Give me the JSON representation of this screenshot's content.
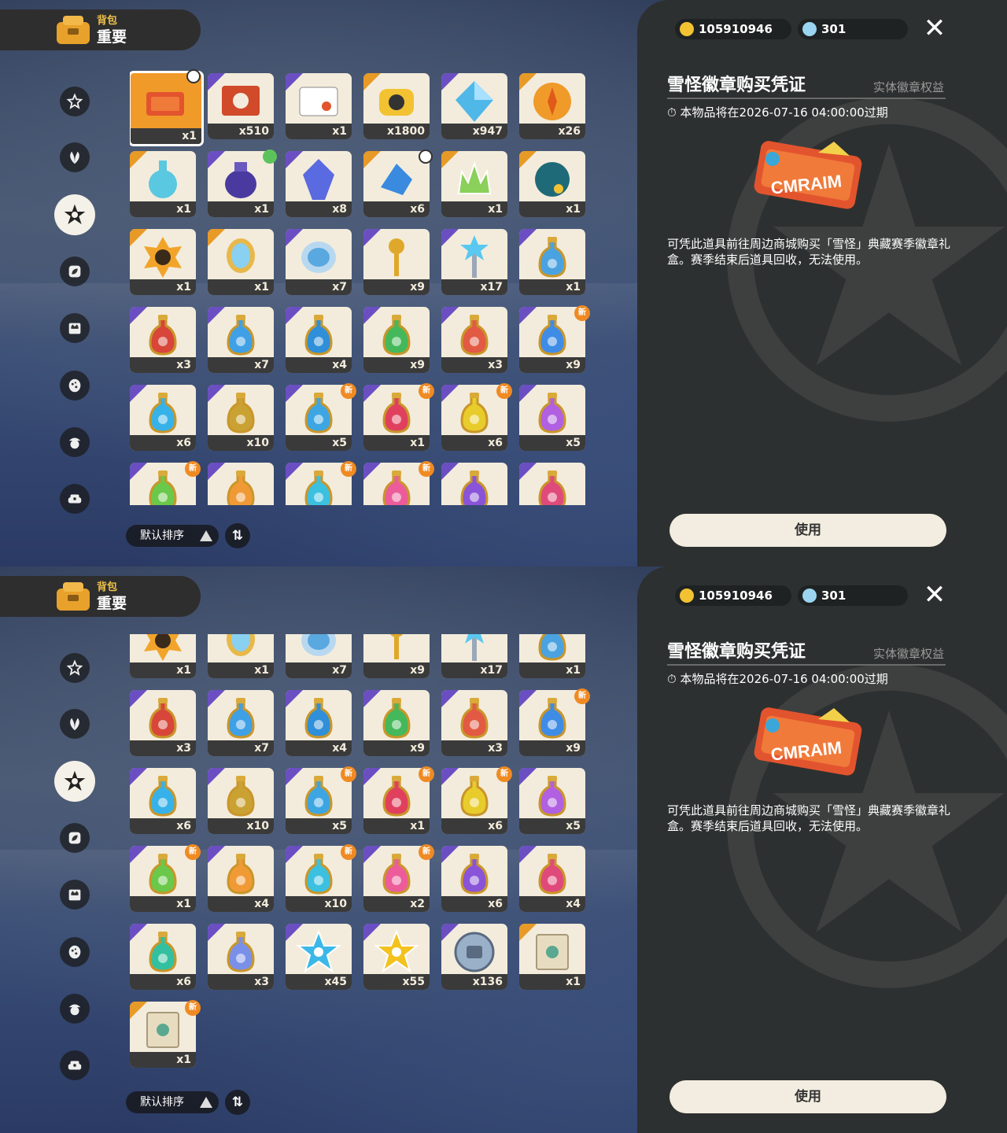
{
  "header": {
    "small": "背包",
    "big": "重要"
  },
  "currency": {
    "coins": "105910946",
    "gems": "301"
  },
  "sidebar": {
    "items": [
      {
        "icon": "star-circle-icon"
      },
      {
        "icon": "leaf-sprout-icon"
      },
      {
        "icon": "special-star-icon"
      },
      {
        "icon": "leaf-cube-icon"
      },
      {
        "icon": "crown-card-icon"
      },
      {
        "icon": "egg-dots-icon"
      },
      {
        "icon": "acorn-icon"
      },
      {
        "icon": "sofa-icon"
      }
    ]
  },
  "sort": {
    "label": "默认排序",
    "swap_label": "⇅"
  },
  "detail": {
    "title": "雪怪徽章购买凭证",
    "tag": "实体徽章权益",
    "expire": "本物品将在2026-07-16 04:00:00过期",
    "description": "可凭此道具前往周边商城购买「雪怪」典藏赛季徽章礼盒。赛季结束后道具回收，无法使用。",
    "use_button": "使用",
    "close": "✕"
  },
  "screen1_items": [
    {
      "icon": "ticket-icon",
      "qty": "x1",
      "bg": "gold",
      "mark": "clock",
      "selected": true
    },
    {
      "icon": "card-rabbit-icon",
      "qty": "x510",
      "bg": "purple"
    },
    {
      "icon": "id-card-icon",
      "qty": "x1",
      "bg": "purple"
    },
    {
      "icon": "camera-icon",
      "qty": "x1800",
      "bg": "gold"
    },
    {
      "icon": "crystal-icon",
      "qty": "x947",
      "bg": "purple"
    },
    {
      "icon": "amber-orb-icon",
      "qty": "x26",
      "bg": "gold"
    },
    {
      "icon": "bottle-icon",
      "qty": "x1",
      "bg": "gold"
    },
    {
      "icon": "pouch-icon",
      "qty": "x1",
      "bg": "purple",
      "mark": "green"
    },
    {
      "icon": "gem-icon",
      "qty": "x8",
      "bg": "purple"
    },
    {
      "icon": "star-shard-icon",
      "qty": "x6",
      "bg": "gold",
      "mark": "clock"
    },
    {
      "icon": "crown-leaf-icon",
      "qty": "x1",
      "bg": "gold"
    },
    {
      "icon": "shell-icon",
      "qty": "x1",
      "bg": "gold"
    },
    {
      "icon": "flower-mask-icon",
      "qty": "x1",
      "bg": "gold"
    },
    {
      "icon": "mirror-icon",
      "qty": "x1",
      "bg": "gold"
    },
    {
      "icon": "mirror-blue-icon",
      "qty": "x7",
      "bg": "purple"
    },
    {
      "icon": "key-icon",
      "qty": "x9",
      "bg": "purple"
    },
    {
      "icon": "wand-icon",
      "qty": "x17",
      "bg": "purple"
    },
    {
      "icon": "rainbow-potion-icon",
      "qty": "x1",
      "bg": "purple"
    },
    {
      "icon": "red-potion-icon",
      "qty": "x3",
      "bg": "purple",
      "color": "#d8463a"
    },
    {
      "icon": "blue-potion-icon",
      "qty": "x7",
      "bg": "purple",
      "color": "#3fa0e6"
    },
    {
      "icon": "blue-potion-icon",
      "qty": "x4",
      "bg": "purple",
      "color": "#2f8fd8"
    },
    {
      "icon": "green-potion-icon",
      "qty": "x9",
      "bg": "purple",
      "color": "#44b85a"
    },
    {
      "icon": "red-potion-icon",
      "qty": "x3",
      "bg": "purple",
      "color": "#e25a43"
    },
    {
      "icon": "blue-potion-icon",
      "qty": "x9",
      "bg": "purple",
      "color": "#3f8ce6",
      "mark": "new"
    },
    {
      "icon": "blue-potion-icon",
      "qty": "x6",
      "bg": "purple",
      "color": "#37b2e8"
    },
    {
      "icon": "gold-potion-icon",
      "qty": "x10",
      "bg": "purple",
      "color": "#caa233"
    },
    {
      "icon": "blue-potion-icon",
      "qty": "x5",
      "bg": "purple",
      "color": "#3da6e2",
      "mark": "new"
    },
    {
      "icon": "red-potion-icon",
      "qty": "x1",
      "bg": "purple",
      "color": "#e0405e",
      "mark": "new"
    },
    {
      "icon": "yellow-potion-icon",
      "qty": "x6",
      "bg": "purple",
      "color": "#e8cc2c",
      "mark": "new"
    },
    {
      "icon": "purple-potion-icon",
      "qty": "x5",
      "bg": "purple",
      "color": "#b060e0"
    },
    {
      "icon": "green-potion-icon",
      "qty": "",
      "bg": "purple",
      "color": "#6ac84a",
      "mark": "new"
    },
    {
      "icon": "orange-potion-icon",
      "qty": "",
      "bg": "purple",
      "color": "#f09a36"
    },
    {
      "icon": "cyan-potion-icon",
      "qty": "",
      "bg": "purple",
      "color": "#3cc0e0",
      "mark": "new"
    },
    {
      "icon": "pink-potion-icon",
      "qty": "",
      "bg": "purple",
      "color": "#ec5c9a",
      "mark": "new"
    },
    {
      "icon": "violet-potion-icon",
      "qty": "",
      "bg": "purple",
      "color": "#8a54d8"
    },
    {
      "icon": "magenta-potion-icon",
      "qty": "",
      "bg": "purple",
      "color": "#e04a7a"
    }
  ],
  "screen2_items": [
    {
      "icon": "flower-mask-icon",
      "qty": "x1",
      "bg": "gold"
    },
    {
      "icon": "mirror-icon",
      "qty": "x1",
      "bg": "gold"
    },
    {
      "icon": "mirror-blue-icon",
      "qty": "x7",
      "bg": "purple"
    },
    {
      "icon": "key-icon",
      "qty": "x9",
      "bg": "purple"
    },
    {
      "icon": "wand-icon",
      "qty": "x17",
      "bg": "purple"
    },
    {
      "icon": "rainbow-potion-icon",
      "qty": "x1",
      "bg": "purple"
    },
    {
      "icon": "red-potion-icon",
      "qty": "x3",
      "bg": "purple",
      "color": "#d8463a"
    },
    {
      "icon": "blue-potion-icon",
      "qty": "x7",
      "bg": "purple",
      "color": "#3fa0e6"
    },
    {
      "icon": "blue-potion-icon",
      "qty": "x4",
      "bg": "purple",
      "color": "#2f8fd8"
    },
    {
      "icon": "green-potion-icon",
      "qty": "x9",
      "bg": "purple",
      "color": "#44b85a"
    },
    {
      "icon": "red-potion-icon",
      "qty": "x3",
      "bg": "purple",
      "color": "#e25a43"
    },
    {
      "icon": "blue-potion-icon",
      "qty": "x9",
      "bg": "purple",
      "color": "#3f8ce6",
      "mark": "new"
    },
    {
      "icon": "blue-potion-icon",
      "qty": "x6",
      "bg": "purple",
      "color": "#37b2e8"
    },
    {
      "icon": "gold-potion-icon",
      "qty": "x10",
      "bg": "purple",
      "color": "#caa233"
    },
    {
      "icon": "blue-potion-icon",
      "qty": "x5",
      "bg": "purple",
      "color": "#3da6e2",
      "mark": "new"
    },
    {
      "icon": "red-potion-icon",
      "qty": "x1",
      "bg": "purple",
      "color": "#e0405e",
      "mark": "new"
    },
    {
      "icon": "yellow-potion-icon",
      "qty": "x6",
      "bg": "purple",
      "color": "#e8cc2c",
      "mark": "new"
    },
    {
      "icon": "purple-potion-icon",
      "qty": "x5",
      "bg": "purple",
      "color": "#b060e0"
    },
    {
      "icon": "green-potion-icon",
      "qty": "x1",
      "bg": "purple",
      "color": "#6ac84a",
      "mark": "new"
    },
    {
      "icon": "orange-potion-icon",
      "qty": "x4",
      "bg": "purple",
      "color": "#f09a36"
    },
    {
      "icon": "cyan-potion-icon",
      "qty": "x10",
      "bg": "purple",
      "color": "#3cc0e0",
      "mark": "new"
    },
    {
      "icon": "pink-potion-icon",
      "qty": "x2",
      "bg": "purple",
      "color": "#ec5c9a",
      "mark": "new"
    },
    {
      "icon": "violet-potion-icon",
      "qty": "x6",
      "bg": "purple",
      "color": "#8a54d8"
    },
    {
      "icon": "magenta-potion-icon",
      "qty": "x4",
      "bg": "purple",
      "color": "#e04a7a"
    },
    {
      "icon": "teal-potion-icon",
      "qty": "x6",
      "bg": "purple",
      "color": "#32c0a0"
    },
    {
      "icon": "swirl-potion-icon",
      "qty": "x3",
      "bg": "purple",
      "color": "#7a90e8"
    },
    {
      "icon": "blue-star-icon",
      "qty": "x45",
      "bg": "purple",
      "color": "#3cb8e8"
    },
    {
      "icon": "gold-star-icon",
      "qty": "x55",
      "bg": "purple",
      "color": "#f2c21e"
    },
    {
      "icon": "medal-coin-icon",
      "qty": "x136",
      "bg": "purple"
    },
    {
      "icon": "scroll-icon",
      "qty": "x1",
      "bg": "gold"
    },
    {
      "icon": "scroll-icon",
      "qty": "x1",
      "bg": "gold",
      "mark": "new"
    }
  ]
}
